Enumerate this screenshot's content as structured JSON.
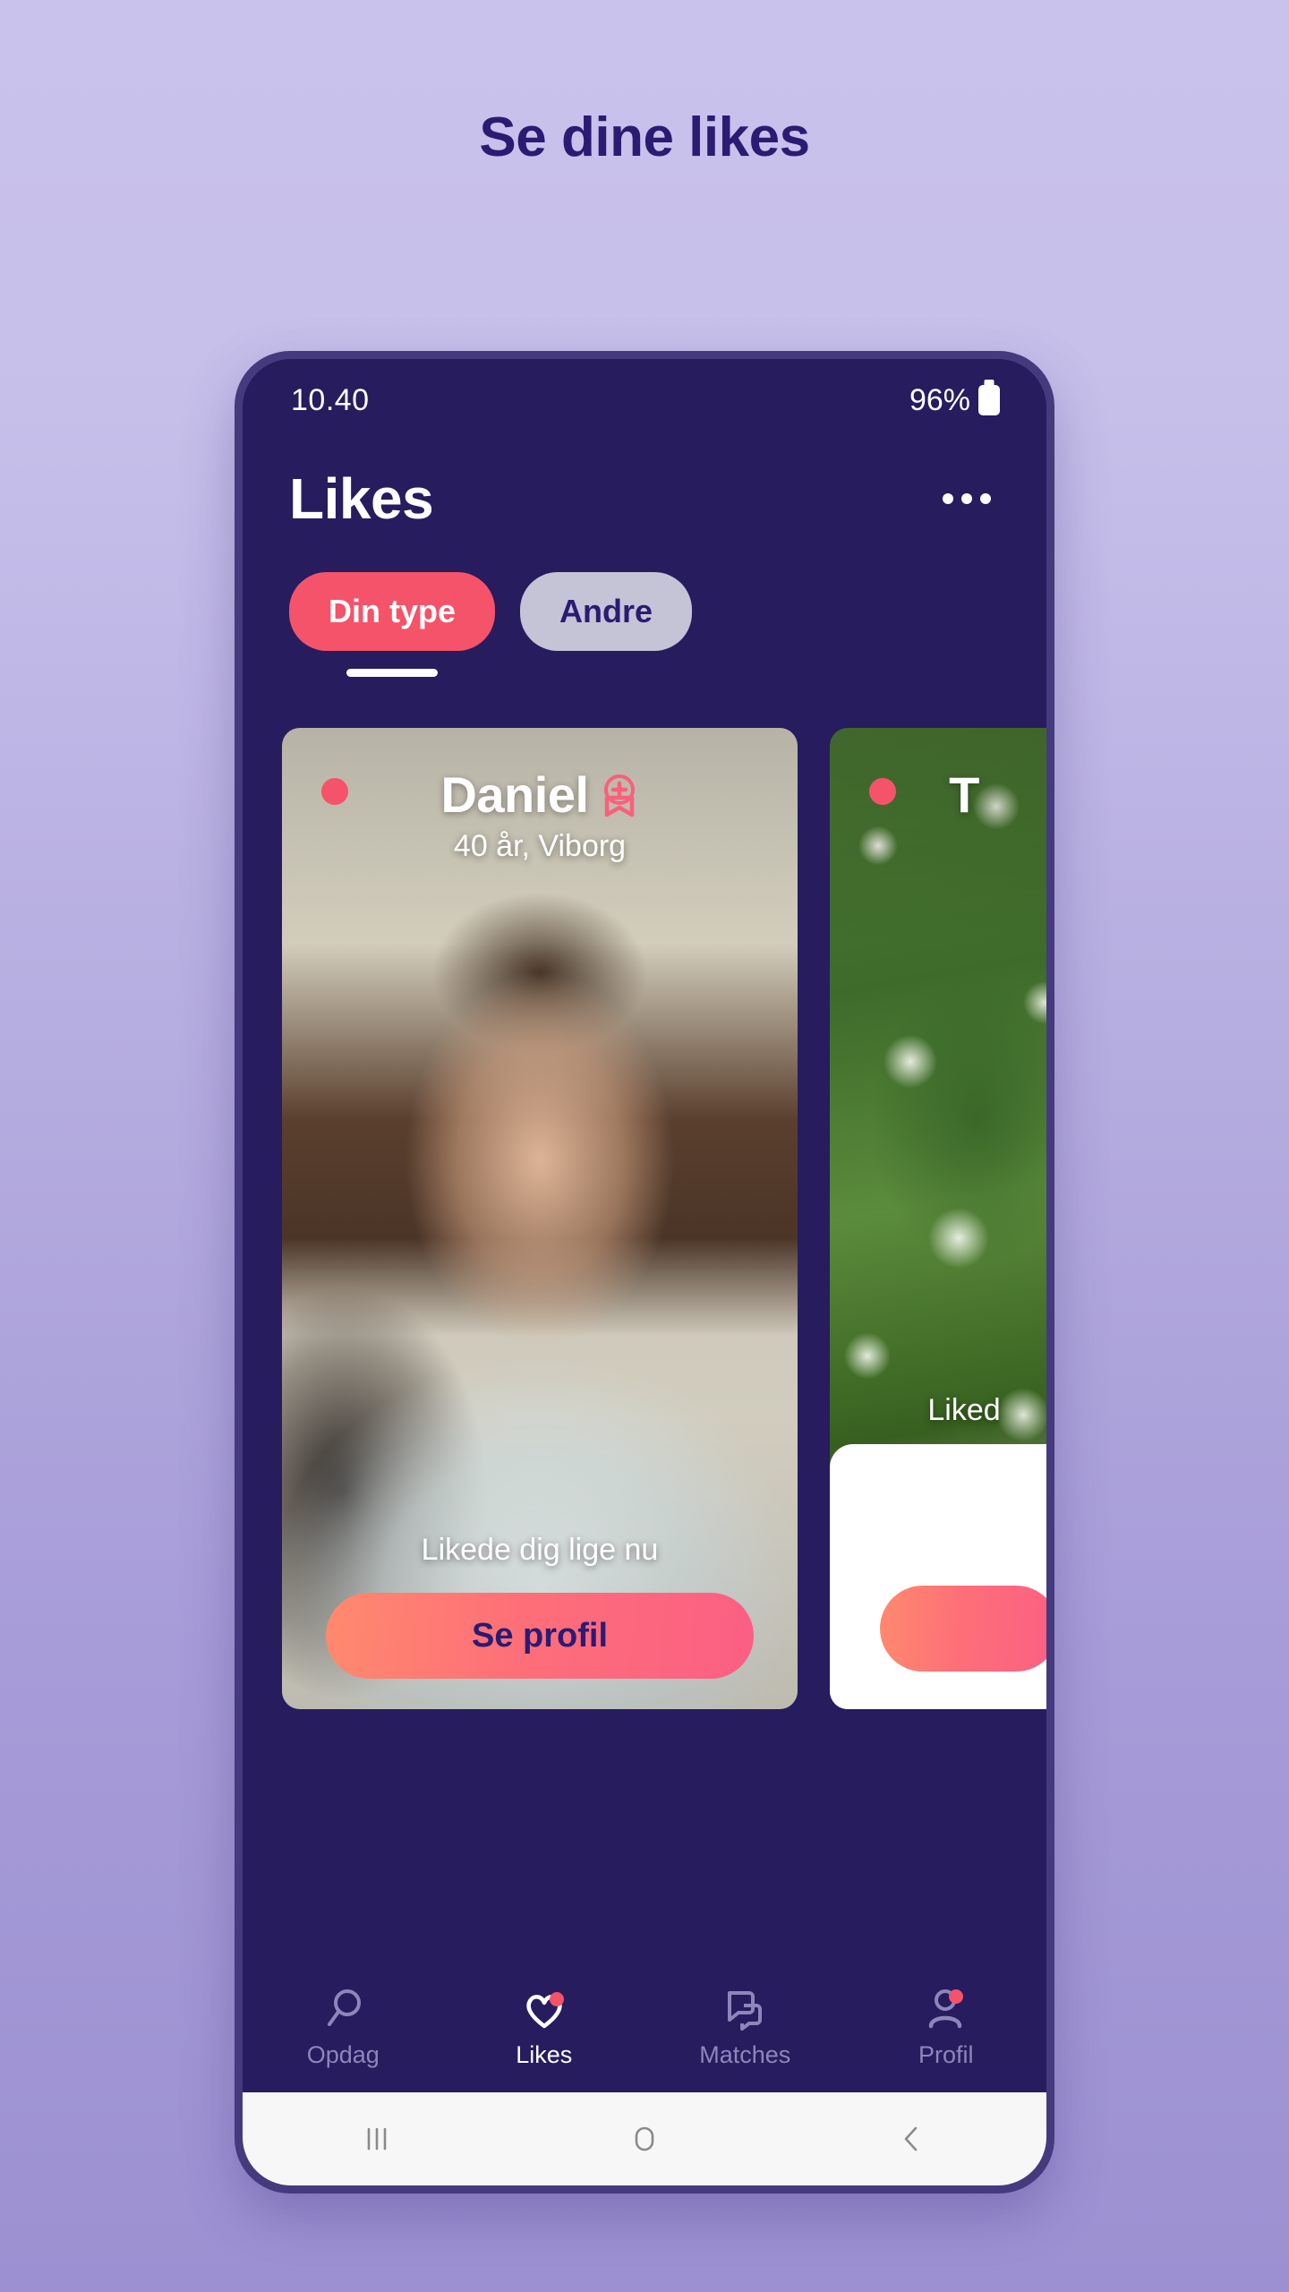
{
  "promo": {
    "headline": "Se dine likes",
    "background_top": "#c9c2ec",
    "background_bottom": "#9c90d2",
    "headline_color": "#2b1b72"
  },
  "phone": {
    "frame_color": "#453a7e",
    "screen_bg": "#261c5e"
  },
  "statusbar": {
    "time": "10.40",
    "battery_percent": "96%",
    "battery_icon": "battery-full-icon"
  },
  "header": {
    "title": "Likes",
    "menu_icon": "kebab-menu-icon"
  },
  "tabs": {
    "active_index": 0,
    "items": [
      {
        "label": "Din type",
        "active": true
      },
      {
        "label": "Andre",
        "active": false
      }
    ],
    "active_color": "#f5536a",
    "inactive_color": "#c5c3d6"
  },
  "cards": [
    {
      "name": "Daniel",
      "subtitle": "40 år, Viborg",
      "status_text": "Likede dig lige nu",
      "cta_label": "Se profil",
      "online": true,
      "badge_icon": "premium-plus-badge-icon",
      "online_dot_color": "#f5536a"
    },
    {
      "name": "T",
      "subtitle": "",
      "status_text": "Liked",
      "cta_label": "",
      "online": true,
      "badge_icon": "premium-plus-badge-icon",
      "online_dot_color": "#f5536a"
    }
  ],
  "bottom_nav": {
    "items": [
      {
        "label": "Opdag",
        "icon": "search-icon",
        "active": false,
        "dot": false
      },
      {
        "label": "Likes",
        "icon": "heart-icon",
        "active": true,
        "dot": true
      },
      {
        "label": "Matches",
        "icon": "chat-bubbles-icon",
        "active": false,
        "dot": false
      },
      {
        "label": "Profil",
        "icon": "person-icon",
        "active": false,
        "dot": true
      }
    ],
    "inactive_color": "#8e86bb",
    "active_color": "#ffffff",
    "dot_color": "#f5536a"
  },
  "system_nav": {
    "recents_icon": "recents-icon",
    "home_icon": "home-icon",
    "back_icon": "back-icon"
  }
}
